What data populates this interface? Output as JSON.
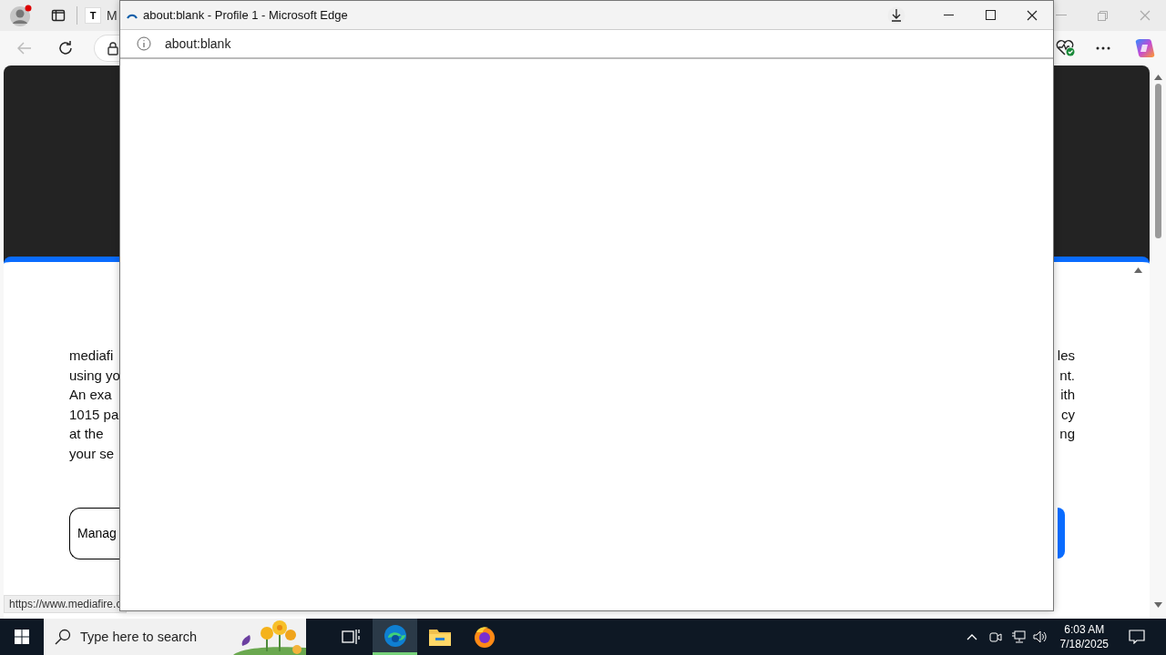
{
  "background_browser": {
    "tab_icon_letter": "T",
    "tab_label": "M",
    "page": {
      "left_lines": [
        "mediafi",
        "using yo",
        "An exa",
        "1015 pa",
        "at the",
        "your se"
      ],
      "right_lines": [
        "les",
        "nt.",
        "ith",
        "cy",
        "ng"
      ],
      "manage_button": "Manag"
    },
    "status_url": "https://www.mediafire.c"
  },
  "popup": {
    "title": "about:blank - Profile 1 - Microsoft Edge",
    "address": "about:blank",
    "loading": true
  },
  "taskbar": {
    "search_placeholder": "Type here to search",
    "apps": [
      {
        "kind": "task-view",
        "selected": false
      },
      {
        "kind": "edge",
        "selected": true
      },
      {
        "kind": "explorer",
        "selected": false
      },
      {
        "kind": "firefox",
        "selected": false
      }
    ],
    "time": "6:03 AM",
    "date": "7/18/2025"
  }
}
